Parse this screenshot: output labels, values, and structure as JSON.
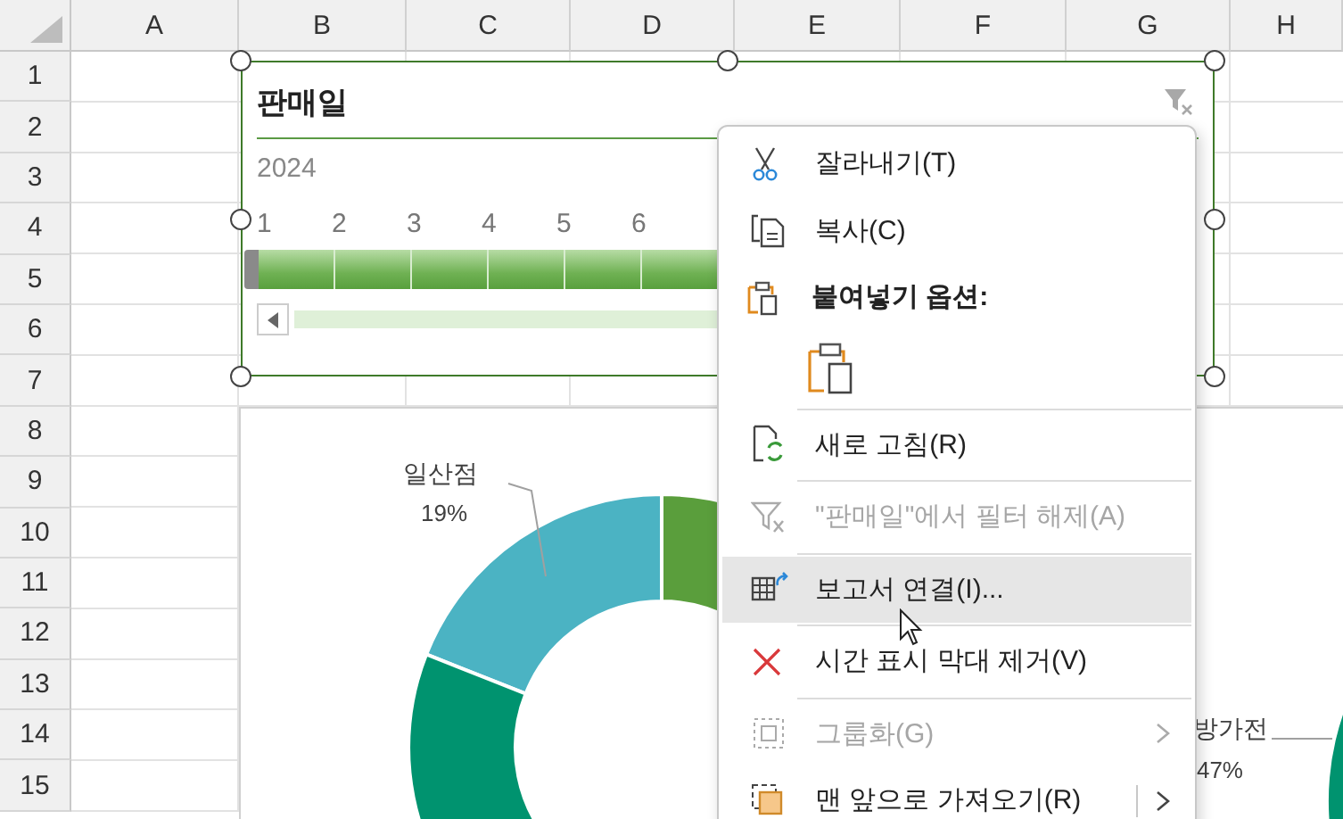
{
  "column_headers": [
    "A",
    "B",
    "C",
    "D",
    "E",
    "F",
    "G",
    "H"
  ],
  "row_headers": [
    "1",
    "2",
    "3",
    "4",
    "5",
    "6",
    "7",
    "8",
    "9",
    "10",
    "11",
    "12",
    "13",
    "14",
    "15"
  ],
  "slicer": {
    "title": "판매일",
    "year": "2024",
    "months": [
      {
        "label": "1",
        "selected": true
      },
      {
        "label": "2",
        "selected": true
      },
      {
        "label": "3",
        "selected": true
      },
      {
        "label": "4",
        "selected": true
      },
      {
        "label": "5",
        "selected": true
      },
      {
        "label": "6",
        "selected": true
      }
    ]
  },
  "chart": {
    "labels": [
      {
        "name": "일산점",
        "percent": "19%"
      },
      {
        "name": "방가전",
        "percent": "47%"
      }
    ]
  },
  "context_menu": {
    "items": [
      {
        "kind": "command",
        "label": "잘라내기(T)",
        "disabled": false,
        "selected": false,
        "submenu": false,
        "split": false
      },
      {
        "kind": "command",
        "label": "복사(C)",
        "disabled": false,
        "selected": false,
        "submenu": false,
        "split": false
      },
      {
        "kind": "header",
        "label": "붙여넣기 옵션:"
      },
      {
        "kind": "paste"
      },
      {
        "kind": "separator"
      },
      {
        "kind": "command",
        "label": "새로 고침(R)",
        "disabled": false,
        "selected": false,
        "submenu": false,
        "split": false
      },
      {
        "kind": "separator"
      },
      {
        "kind": "command",
        "label": "\"판매일\"에서 필터 해제(A)",
        "disabled": true,
        "selected": false,
        "submenu": false,
        "split": false
      },
      {
        "kind": "separator"
      },
      {
        "kind": "command",
        "label": "보고서 연결(I)...",
        "disabled": false,
        "selected": true,
        "submenu": false,
        "split": false
      },
      {
        "kind": "separator"
      },
      {
        "kind": "command",
        "label": "시간 표시 막대 제거(V)",
        "disabled": false,
        "selected": false,
        "submenu": false,
        "split": false
      },
      {
        "kind": "separator"
      },
      {
        "kind": "command",
        "label": "그룹화(G)",
        "disabled": true,
        "selected": false,
        "submenu": true,
        "split": false
      },
      {
        "kind": "command",
        "label": "맨 앞으로 가져오기(R)",
        "disabled": false,
        "selected": false,
        "submenu": true,
        "split": true
      }
    ]
  }
}
